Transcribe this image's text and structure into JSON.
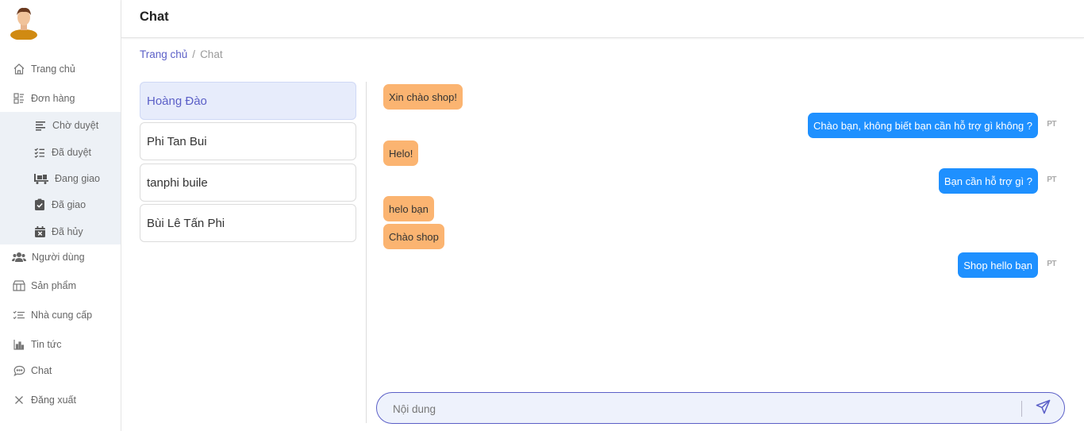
{
  "page": {
    "title": "Chat"
  },
  "breadcrumb": {
    "home": "Trang chủ",
    "sep": "/",
    "current": "Chat"
  },
  "sidebar": {
    "items": [
      {
        "label": "Trang chủ",
        "icon": "home-icon"
      },
      {
        "label": "Đơn hàng",
        "icon": "orders-icon"
      },
      {
        "label": "Người dùng",
        "icon": "users-icon"
      },
      {
        "label": "Sản phẩm",
        "icon": "products-icon"
      },
      {
        "label": "Nhà cung cấp",
        "icon": "suppliers-icon"
      },
      {
        "label": "Tin tức",
        "icon": "news-icon"
      },
      {
        "label": "Chat",
        "icon": "chat-icon"
      },
      {
        "label": "Đăng xuất",
        "icon": "logout-icon"
      }
    ],
    "sub_items": [
      {
        "label": "Chờ duyệt",
        "icon": "pending-list-icon"
      },
      {
        "label": "Đã duyệt",
        "icon": "approved-list-icon"
      },
      {
        "label": "Đang giao",
        "icon": "delivery-truck-icon"
      },
      {
        "label": "Đã giao",
        "icon": "clipboard-check-icon"
      },
      {
        "label": "Đã hủy",
        "icon": "calendar-cancel-icon"
      }
    ]
  },
  "conversations": [
    {
      "name": "Hoàng Đào",
      "active": true
    },
    {
      "name": "Phi Tan Bui",
      "active": false
    },
    {
      "name": "tanphi buile",
      "active": false
    },
    {
      "name": "Bùi Lê Tấn Phi",
      "active": false
    }
  ],
  "messages": [
    {
      "from": "customer",
      "text": "Xin chào shop!"
    },
    {
      "from": "admin",
      "text": "Chào bạn, không biết bạn cần hỗ trợ gì không ?",
      "avatar_text": "PT"
    },
    {
      "from": "customer",
      "text": "Helo!"
    },
    {
      "from": "admin",
      "text": "Bạn cần hỗ trợ gì ?",
      "avatar_text": "PT"
    },
    {
      "from": "customer",
      "text": "helo bạn"
    },
    {
      "from": "customer",
      "text": "Chào shop"
    },
    {
      "from": "admin",
      "text": "Shop hello bạn",
      "avatar_text": "PT"
    }
  ],
  "composer": {
    "placeholder": "Nội dung",
    "send_icon": "send-icon"
  },
  "colors": {
    "accent": "#5b5fc7",
    "incoming_bubble": "#fbb471",
    "outgoing_bubble": "#1e90ff",
    "active_conversation": "#e7ecfb",
    "submenu_bg": "#edf1f6"
  }
}
